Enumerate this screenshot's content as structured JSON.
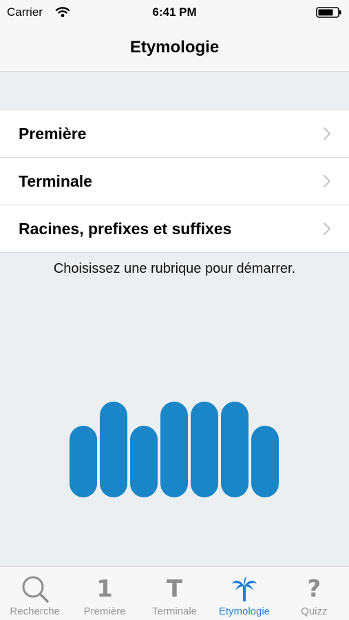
{
  "status_bar": {
    "carrier": "Carrier",
    "time": "6:41 PM"
  },
  "nav": {
    "title": "Etymologie"
  },
  "list": {
    "items": [
      {
        "label": "Première"
      },
      {
        "label": "Terminale"
      },
      {
        "label": "Racines, prefixes et suffixes"
      }
    ]
  },
  "hint": "Choisissez une rubrique pour démarrer.",
  "tab_bar": {
    "items": [
      {
        "label": "Recherche",
        "icon": "search-icon"
      },
      {
        "label": "Première",
        "icon": "digit-one-icon",
        "glyph": "1"
      },
      {
        "label": "Terminale",
        "icon": "letter-t-icon",
        "glyph": "T"
      },
      {
        "label": "Etymologie",
        "icon": "palm-tree-icon",
        "active": true
      },
      {
        "label": "Quizz",
        "icon": "question-mark-icon",
        "glyph": "?"
      }
    ]
  },
  "colors": {
    "accent": "#1E7FE0",
    "logo_blue": "#1A86C7",
    "inactive_tab": "#929292",
    "background": "#ECEFF2"
  }
}
